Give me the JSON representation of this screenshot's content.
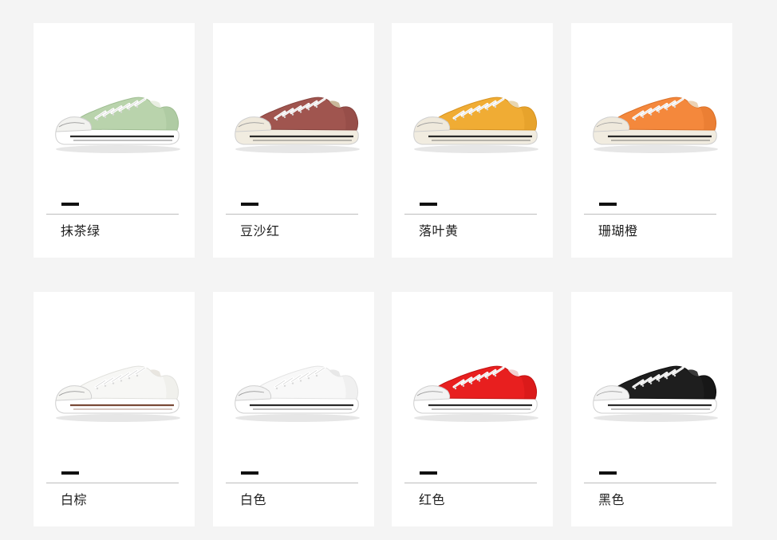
{
  "products": [
    {
      "color_name": "抹茶绿",
      "upper_color": "#b9d3ac",
      "upper_shade": "#9fbd92",
      "lace_color": "#ffffff",
      "foxing_stripe": "#2a2a2a",
      "sole_color": "#ffffff",
      "toe_color": "#f2f2ef",
      "heel_tab": "#e9eee2"
    },
    {
      "color_name": "豆沙红",
      "upper_color": "#a0554f",
      "upper_shade": "#86433e",
      "lace_color": "#ffffff",
      "foxing_stripe": "#2a2a2a",
      "sole_color": "#f1ece0",
      "toe_color": "#efe9dc",
      "heel_tab": "#c9b89a"
    },
    {
      "color_name": "落叶黄",
      "upper_color": "#f0ac34",
      "upper_shade": "#d6921f",
      "lace_color": "#ffffff",
      "foxing_stripe": "#2a2a2a",
      "sole_color": "#f1ece0",
      "toe_color": "#efe9dc",
      "heel_tab": "#e8d6b0"
    },
    {
      "color_name": "珊瑚橙",
      "upper_color": "#f4883c",
      "upper_shade": "#da6f26",
      "lace_color": "#ffffff",
      "foxing_stripe": "#2a2a2a",
      "sole_color": "#f1ece0",
      "toe_color": "#efe9dc",
      "heel_tab": "#ecd2b4"
    },
    {
      "color_name": "白棕",
      "upper_color": "#f7f7f5",
      "upper_shade": "#e1e1dd",
      "lace_color": "#ffffff",
      "foxing_stripe": "#7a4a36",
      "sole_color": "#ffffff",
      "toe_color": "#f5f5f2",
      "heel_tab": "#e9e6e0"
    },
    {
      "color_name": "白色",
      "upper_color": "#f8f8f8",
      "upper_shade": "#e3e3e3",
      "lace_color": "#ffffff",
      "foxing_stripe": "#2a2a2a",
      "sole_color": "#ffffff",
      "toe_color": "#f3f3f3",
      "heel_tab": "#e8e8e8"
    },
    {
      "color_name": "红色",
      "upper_color": "#e81f1f",
      "upper_shade": "#c21212",
      "lace_color": "#ffffff",
      "foxing_stripe": "#2a2a2a",
      "sole_color": "#ffffff",
      "toe_color": "#f3f3f3",
      "heel_tab": "#f2d0d0"
    },
    {
      "color_name": "黑色",
      "upper_color": "#1e1e1e",
      "upper_shade": "#0c0c0c",
      "lace_color": "#ffffff",
      "foxing_stripe": "#2a2a2a",
      "sole_color": "#ffffff",
      "toe_color": "#f3f3f3",
      "heel_tab": "#3a3a3a"
    }
  ]
}
